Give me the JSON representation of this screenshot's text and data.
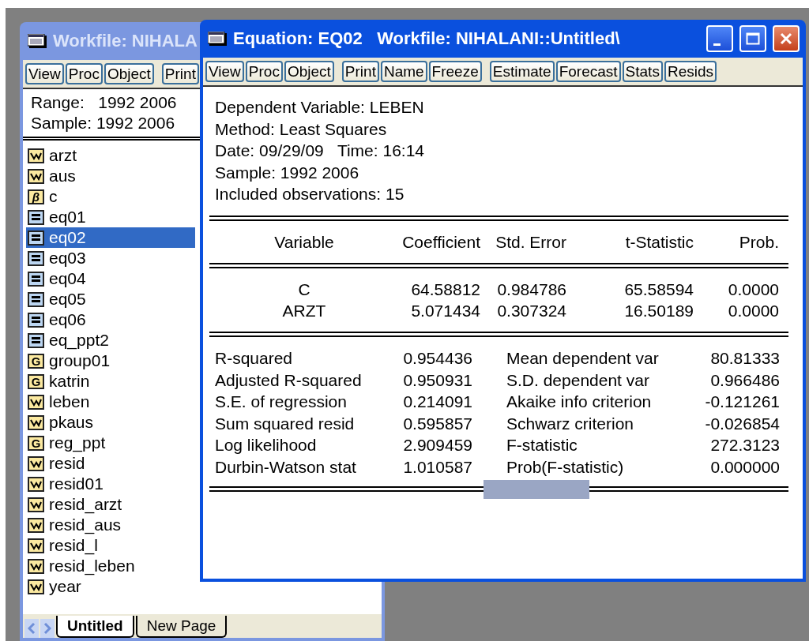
{
  "workfile_window": {
    "title": "Workfile: NIHALA",
    "active": false,
    "toolbar": [
      "View",
      "Proc",
      "Object",
      "Print"
    ],
    "range": {
      "label": "Range:",
      "value": "1992 2006"
    },
    "sample": {
      "label": "Sample:",
      "value": "1992 2006"
    },
    "objects": [
      {
        "name": "arzt",
        "kind": "series",
        "selected": false
      },
      {
        "name": "aus",
        "kind": "series",
        "selected": false
      },
      {
        "name": "c",
        "kind": "coef",
        "glyph": "β",
        "selected": false
      },
      {
        "name": "eq01",
        "kind": "equation",
        "selected": false
      },
      {
        "name": "eq02",
        "kind": "equation",
        "selected": true
      },
      {
        "name": "eq03",
        "kind": "equation",
        "selected": false
      },
      {
        "name": "eq04",
        "kind": "equation",
        "selected": false
      },
      {
        "name": "eq05",
        "kind": "equation",
        "selected": false
      },
      {
        "name": "eq06",
        "kind": "equation",
        "selected": false
      },
      {
        "name": "eq_ppt2",
        "kind": "equation",
        "selected": false
      },
      {
        "name": "group01",
        "kind": "group",
        "glyph": "G",
        "selected": false
      },
      {
        "name": "katrin",
        "kind": "group",
        "glyph": "G",
        "selected": false
      },
      {
        "name": "leben",
        "kind": "series",
        "selected": false
      },
      {
        "name": "pkaus",
        "kind": "series",
        "selected": false
      },
      {
        "name": "reg_ppt",
        "kind": "group",
        "glyph": "G",
        "selected": false
      },
      {
        "name": "resid",
        "kind": "series",
        "selected": false
      },
      {
        "name": "resid01",
        "kind": "series",
        "selected": false
      },
      {
        "name": "resid_arzt",
        "kind": "series",
        "selected": false
      },
      {
        "name": "resid_aus",
        "kind": "series",
        "selected": false
      },
      {
        "name": "resid_l",
        "kind": "series",
        "selected": false
      },
      {
        "name": "resid_leben",
        "kind": "series",
        "selected": false
      },
      {
        "name": "year",
        "kind": "series",
        "selected": false
      }
    ],
    "tabs": [
      {
        "label": "Untitled",
        "selected": true
      },
      {
        "label": "New Page",
        "selected": false
      }
    ]
  },
  "equation_window": {
    "title": "Equation: EQ02   Workfile: NIHALANI::Untitled\\",
    "active": true,
    "toolbar_groups": [
      [
        "View",
        "Proc",
        "Object"
      ],
      [
        "Print",
        "Name",
        "Freeze"
      ],
      [
        "Estimate",
        "Forecast",
        "Stats",
        "Resids"
      ]
    ],
    "header_lines": [
      "Dependent Variable: LEBEN",
      "Method: Least Squares",
      "Date: 09/29/09   Time: 16:14",
      "Sample: 1992 2006",
      "Included observations: 15"
    ],
    "table": {
      "columns": [
        "Variable",
        "Coefficient",
        "Std. Error",
        "t-Statistic",
        "Prob."
      ],
      "rows": [
        [
          "C",
          "64.58812",
          "0.984786",
          "65.58594",
          "0.0000"
        ],
        [
          "ARZT",
          "5.071434",
          "0.307324",
          "16.50189",
          "0.0000"
        ]
      ]
    },
    "statistics": [
      [
        "R-squared",
        "0.954436",
        "Mean dependent var",
        "80.81333"
      ],
      [
        "Adjusted R-squared",
        "0.950931",
        "S.D. dependent var",
        "0.966486"
      ],
      [
        "S.E. of regression",
        "0.214091",
        "Akaike info criterion",
        "-0.121261"
      ],
      [
        "Sum squared resid",
        "0.595857",
        "Schwarz criterion",
        "-0.026854"
      ],
      [
        "Log likelihood",
        "2.909459",
        "F-statistic",
        "272.3123"
      ],
      [
        "Durbin-Watson stat",
        "1.010587",
        "Prob(F-statistic)",
        "0.000000"
      ]
    ]
  }
}
